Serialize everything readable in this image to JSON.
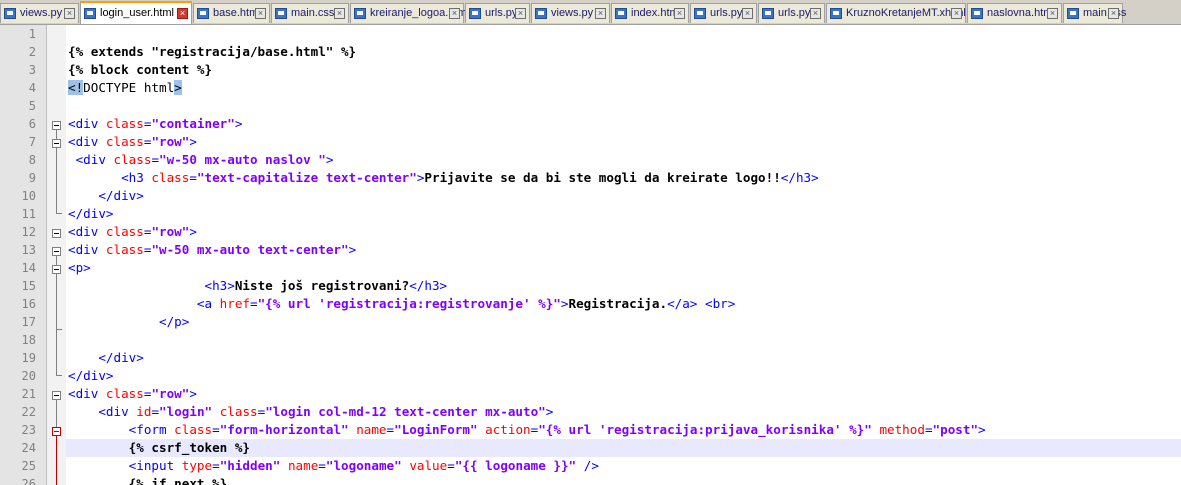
{
  "tabs": [
    {
      "label": "views.py",
      "active": false
    },
    {
      "label": "login_user.html",
      "active": true
    },
    {
      "label": "base.html",
      "active": false
    },
    {
      "label": "main.css",
      "active": false
    },
    {
      "label": "kreiranje_logoa.html",
      "active": false
    },
    {
      "label": "urls.py",
      "active": false
    },
    {
      "label": "views.py",
      "active": false
    },
    {
      "label": "index.html",
      "active": false
    },
    {
      "label": "urls.py",
      "active": false
    },
    {
      "label": "urls.py",
      "active": false
    },
    {
      "label": "KruznoKretanjeMT.xhtml",
      "active": false
    },
    {
      "label": "naslovna.html",
      "active": false
    },
    {
      "label": "main.css",
      "active": false
    }
  ],
  "colors": {
    "tag": "#0000ff",
    "attribute": "#ff0000",
    "value": "#8000ff",
    "current_line": "#e8e8ff",
    "active_tab_accent": "#ffa000"
  },
  "lines": [
    {
      "n": "1",
      "tokens": []
    },
    {
      "n": "2",
      "tokens": [
        [
          "tpl",
          "{% extends \"registracija/base.html\" %}"
        ]
      ]
    },
    {
      "n": "3",
      "tokens": [
        [
          "tpl",
          "{% block content %}"
        ]
      ]
    },
    {
      "n": "4",
      "tokens": [
        [
          "hl",
          "<!"
        ],
        [
          "doc",
          "DOCTYPE html"
        ],
        [
          "hl",
          ">"
        ]
      ]
    },
    {
      "n": "5",
      "tokens": []
    },
    {
      "n": "6",
      "tokens": [
        [
          "tag",
          "<div "
        ],
        [
          "attr",
          "class"
        ],
        [
          "tag",
          "="
        ],
        [
          "val",
          "\"container\""
        ],
        [
          "tag",
          ">"
        ]
      ]
    },
    {
      "n": "7",
      "tokens": [
        [
          "tag",
          "<div "
        ],
        [
          "attr",
          "class"
        ],
        [
          "tag",
          "="
        ],
        [
          "val",
          "\"row\""
        ],
        [
          "tag",
          ">"
        ]
      ]
    },
    {
      "n": "8",
      "tokens": [
        [
          "txt",
          " "
        ],
        [
          "tag",
          "<div "
        ],
        [
          "attr",
          "class"
        ],
        [
          "tag",
          "="
        ],
        [
          "val",
          "\"w-50 mx-auto naslov \""
        ],
        [
          "tag",
          ">"
        ]
      ]
    },
    {
      "n": "9",
      "tokens": [
        [
          "txt",
          "       "
        ],
        [
          "tag",
          "<h3 "
        ],
        [
          "attr",
          "class"
        ],
        [
          "tag",
          "="
        ],
        [
          "val",
          "\"text-capitalize text-center\""
        ],
        [
          "tag",
          ">"
        ],
        [
          "txt",
          "Prijavite se da bi ste mogli da kreirate logo!!"
        ],
        [
          "tag",
          "</h3>"
        ]
      ]
    },
    {
      "n": "10",
      "tokens": [
        [
          "txt",
          "    "
        ],
        [
          "tag",
          "</div>"
        ]
      ]
    },
    {
      "n": "11",
      "tokens": [
        [
          "tag",
          "</div>"
        ]
      ]
    },
    {
      "n": "12",
      "tokens": [
        [
          "tag",
          "<div "
        ],
        [
          "attr",
          "class"
        ],
        [
          "tag",
          "="
        ],
        [
          "val",
          "\"row\""
        ],
        [
          "tag",
          ">"
        ]
      ]
    },
    {
      "n": "13",
      "tokens": [
        [
          "tag",
          "<div "
        ],
        [
          "attr",
          "class"
        ],
        [
          "tag",
          "="
        ],
        [
          "val",
          "\"w-50 mx-auto text-center\""
        ],
        [
          "tag",
          ">"
        ]
      ]
    },
    {
      "n": "14",
      "tokens": [
        [
          "tag",
          "<p>"
        ]
      ]
    },
    {
      "n": "15",
      "tokens": [
        [
          "txt",
          "                  "
        ],
        [
          "tag",
          "<h3>"
        ],
        [
          "txt",
          "Niste još registrovani?"
        ],
        [
          "tag",
          "</h3>"
        ]
      ]
    },
    {
      "n": "16",
      "tokens": [
        [
          "txt",
          "                 "
        ],
        [
          "tag",
          "<a "
        ],
        [
          "attr",
          "href"
        ],
        [
          "tag",
          "="
        ],
        [
          "val",
          "\"{% url 'registracija:registrovanje' %}\""
        ],
        [
          "tag",
          ">"
        ],
        [
          "txt",
          "Registracija."
        ],
        [
          "tag",
          "</a>"
        ],
        [
          "txt",
          " "
        ],
        [
          "tag",
          "<br>"
        ]
      ]
    },
    {
      "n": "17",
      "tokens": [
        [
          "txt",
          "            "
        ],
        [
          "tag",
          "</p>"
        ]
      ]
    },
    {
      "n": "18",
      "tokens": []
    },
    {
      "n": "19",
      "tokens": [
        [
          "txt",
          "    "
        ],
        [
          "tag",
          "</div>"
        ]
      ]
    },
    {
      "n": "20",
      "tokens": [
        [
          "tag",
          "</div>"
        ]
      ]
    },
    {
      "n": "21",
      "tokens": [
        [
          "tag",
          "<div "
        ],
        [
          "attr",
          "class"
        ],
        [
          "tag",
          "="
        ],
        [
          "val",
          "\"row\""
        ],
        [
          "tag",
          ">"
        ]
      ]
    },
    {
      "n": "22",
      "tokens": [
        [
          "txt",
          "    "
        ],
        [
          "tag",
          "<div "
        ],
        [
          "attr",
          "id"
        ],
        [
          "tag",
          "="
        ],
        [
          "val",
          "\"login\""
        ],
        [
          "txt",
          " "
        ],
        [
          "attr",
          "class"
        ],
        [
          "tag",
          "="
        ],
        [
          "val",
          "\"login col-md-12 text-center mx-auto\""
        ],
        [
          "tag",
          ">"
        ]
      ]
    },
    {
      "n": "23",
      "tokens": [
        [
          "txt",
          "        "
        ],
        [
          "tag",
          "<form "
        ],
        [
          "attr",
          "class"
        ],
        [
          "tag",
          "="
        ],
        [
          "val",
          "\"form-horizontal\""
        ],
        [
          "txt",
          " "
        ],
        [
          "attr",
          "name"
        ],
        [
          "tag",
          "="
        ],
        [
          "val",
          "\"LoginForm\""
        ],
        [
          "txt",
          " "
        ],
        [
          "attr",
          "action"
        ],
        [
          "tag",
          "="
        ],
        [
          "val",
          "\"{% url 'registracija:prijava_korisnika' %}\""
        ],
        [
          "txt",
          " "
        ],
        [
          "attr",
          "method"
        ],
        [
          "tag",
          "="
        ],
        [
          "val",
          "\"post\""
        ],
        [
          "tag",
          ">"
        ]
      ]
    },
    {
      "n": "24",
      "tokens": [
        [
          "txt",
          "        "
        ],
        [
          "tpl",
          "{% csrf_token %}"
        ]
      ]
    },
    {
      "n": "25",
      "tokens": [
        [
          "txt",
          "        "
        ],
        [
          "tag",
          "<input "
        ],
        [
          "attr",
          "type"
        ],
        [
          "tag",
          "="
        ],
        [
          "val",
          "\"hidden\""
        ],
        [
          "txt",
          " "
        ],
        [
          "attr",
          "name"
        ],
        [
          "tag",
          "="
        ],
        [
          "val",
          "\"logoname\""
        ],
        [
          "txt",
          " "
        ],
        [
          "attr",
          "value"
        ],
        [
          "tag",
          "="
        ],
        [
          "val",
          "\"{{ logoname }}\""
        ],
        [
          "txt",
          " "
        ],
        [
          "tag",
          "/>"
        ]
      ]
    },
    {
      "n": "26",
      "tokens": [
        [
          "txt",
          "        "
        ],
        [
          "tpl",
          "{% if next %}"
        ]
      ]
    }
  ],
  "current_line": 24
}
